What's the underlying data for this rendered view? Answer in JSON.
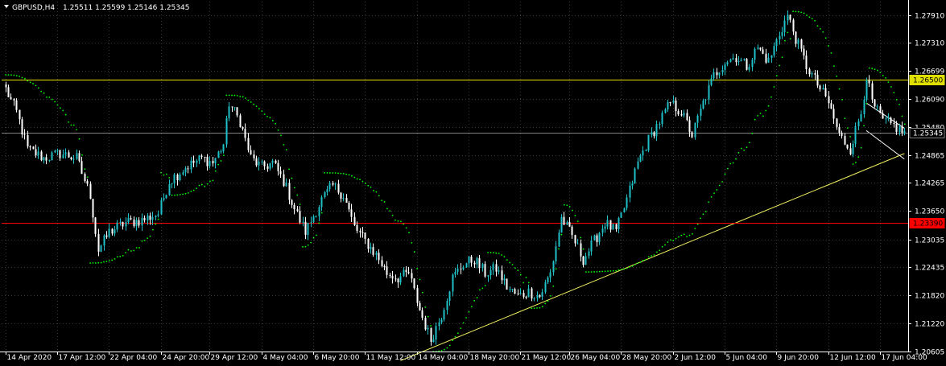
{
  "header": {
    "symbol": "GBPUSD,H4",
    "ohlc": "1.25511 1.25599 1.25146 1.25345"
  },
  "colors": {
    "background": "#000000",
    "grid": "#3a3a3a",
    "bull_candle": "#20c0c8",
    "bear_candle": "#ffffff",
    "parabolic_sar": "#00ff00",
    "resistance_line": "#e0e000",
    "support_line": "#ff0000",
    "trend_line": "#f0f060",
    "bid_line": "#808080",
    "channel_lines": "#ffffff"
  },
  "chart_data": {
    "type": "candlestick",
    "instrument": "GBPUSD",
    "timeframe": "H4",
    "ylim": [
      1.206,
      1.282
    ],
    "y_ticks": [
      "1.27910",
      "1.27310",
      "1.26699",
      "1.26090",
      "1.25480",
      "1.24865",
      "1.24265",
      "1.23650",
      "1.23035",
      "1.22435",
      "1.21820",
      "1.21220",
      "1.20605"
    ],
    "x_tick_labels": [
      "14 Apr 2020",
      "17 Apr 12:00",
      "22 Apr 04:00",
      "24 Apr 20:00",
      "29 Apr 12:00",
      "4 May 04:00",
      "6 May 20:00",
      "11 May 12:00",
      "14 May 04:00",
      "18 May 20:00",
      "21 May 12:00",
      "26 May 04:00",
      "28 May 20:00",
      "2 Jun 12:00",
      "5 Jun 04:00",
      "9 Jun 20:00",
      "12 Jun 12:00",
      "17 Jun 04:00"
    ],
    "close_path": [
      [
        0,
        1.263
      ],
      [
        4,
        1.258
      ],
      [
        8,
        1.25
      ],
      [
        14,
        1.248
      ],
      [
        20,
        1.249
      ],
      [
        26,
        1.248
      ],
      [
        31,
        1.24
      ],
      [
        34,
        1.228
      ],
      [
        38,
        1.232
      ],
      [
        44,
        1.234
      ],
      [
        50,
        1.2345
      ],
      [
        56,
        1.236
      ],
      [
        60,
        1.243
      ],
      [
        66,
        1.246
      ],
      [
        72,
        1.248
      ],
      [
        76,
        1.247
      ],
      [
        80,
        1.251
      ],
      [
        82,
        1.26
      ],
      [
        86,
        1.256
      ],
      [
        90,
        1.248
      ],
      [
        94,
        1.246
      ],
      [
        98,
        1.247
      ],
      [
        102,
        1.243
      ],
      [
        106,
        1.237
      ],
      [
        110,
        1.232
      ],
      [
        116,
        1.239
      ],
      [
        120,
        1.242
      ],
      [
        124,
        1.24
      ],
      [
        128,
        1.233
      ],
      [
        132,
        1.23
      ],
      [
        136,
        1.227
      ],
      [
        140,
        1.223
      ],
      [
        144,
        1.222
      ],
      [
        148,
        1.223
      ],
      [
        152,
        1.215
      ],
      [
        156,
        1.2085
      ],
      [
        160,
        1.214
      ],
      [
        164,
        1.222
      ],
      [
        168,
        1.225
      ],
      [
        172,
        1.226
      ],
      [
        176,
        1.223
      ],
      [
        180,
        1.224
      ],
      [
        184,
        1.22
      ],
      [
        188,
        1.218
      ],
      [
        192,
        1.219
      ],
      [
        196,
        1.218
      ],
      [
        200,
        1.223
      ],
      [
        204,
        1.235
      ],
      [
        208,
        1.231
      ],
      [
        212,
        1.226
      ],
      [
        216,
        1.23
      ],
      [
        220,
        1.234
      ],
      [
        224,
        1.232
      ],
      [
        228,
        1.239
      ],
      [
        232,
        1.247
      ],
      [
        236,
        1.252
      ],
      [
        240,
        1.256
      ],
      [
        244,
        1.26
      ],
      [
        248,
        1.258
      ],
      [
        252,
        1.253
      ],
      [
        256,
        1.26
      ],
      [
        260,
        1.266
      ],
      [
        264,
        1.269
      ],
      [
        268,
        1.27
      ],
      [
        272,
        1.268
      ],
      [
        276,
        1.272
      ],
      [
        280,
        1.269
      ],
      [
        284,
        1.275
      ],
      [
        287,
        1.279
      ],
      [
        290,
        1.274
      ],
      [
        294,
        1.268
      ],
      [
        298,
        1.264
      ],
      [
        302,
        1.26
      ],
      [
        306,
        1.253
      ],
      [
        310,
        1.25
      ],
      [
        314,
        1.258
      ],
      [
        316,
        1.266
      ],
      [
        318,
        1.26
      ],
      [
        322,
        1.256
      ],
      [
        326,
        1.255
      ],
      [
        330,
        1.2535
      ]
    ],
    "psar": {
      "segments": [
        {
          "direction": "above",
          "from": 0,
          "to": 30
        },
        {
          "direction": "below",
          "from": 31,
          "to": 56
        },
        {
          "direction": "above",
          "from": 57,
          "to": 60
        },
        {
          "direction": "below",
          "from": 61,
          "to": 80
        },
        {
          "direction": "above",
          "from": 81,
          "to": 108
        },
        {
          "direction": "below",
          "from": 109,
          "to": 116
        },
        {
          "direction": "above",
          "from": 117,
          "to": 156
        },
        {
          "direction": "below",
          "from": 157,
          "to": 176
        },
        {
          "direction": "above",
          "from": 177,
          "to": 192
        },
        {
          "direction": "below",
          "from": 193,
          "to": 204
        },
        {
          "direction": "above",
          "from": 205,
          "to": 212
        },
        {
          "direction": "below",
          "from": 213,
          "to": 288
        },
        {
          "direction": "above",
          "from": 289,
          "to": 310
        },
        {
          "direction": "below",
          "from": 311,
          "to": 316
        },
        {
          "direction": "above",
          "from": 317,
          "to": 330
        }
      ]
    },
    "horizontal_levels": [
      {
        "price": 1.265,
        "label": "1.26500",
        "color": "#e0e000",
        "label_bg": "#e0e000",
        "label_fg": "#000000"
      },
      {
        "price": 1.25345,
        "label": "1.25345",
        "color": "#808080",
        "label_bg": "#000000",
        "label_fg": "#ffffff"
      },
      {
        "price": 1.2339,
        "label": "1.23390",
        "color": "#ff0000",
        "label_bg": "#ff0000",
        "label_fg": "#000000"
      }
    ],
    "trend_lines": [
      {
        "name": "rising-support",
        "from": [
          145,
          1.204
        ],
        "to": [
          330,
          1.249
        ],
        "color": "#f0f060"
      },
      {
        "name": "channel-upper",
        "from": [
          316,
          1.26
        ],
        "to": [
          330,
          1.2545
        ],
        "color": "#ffffff"
      },
      {
        "name": "channel-lower",
        "from": [
          316,
          1.254
        ],
        "to": [
          330,
          1.2478
        ],
        "color": "#ffffff"
      }
    ],
    "bar_count": 331
  }
}
